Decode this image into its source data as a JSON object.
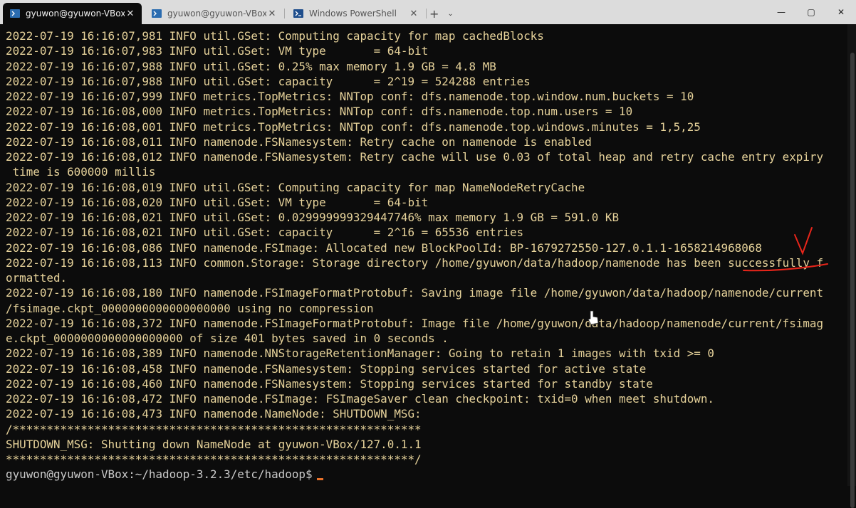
{
  "tabs": [
    {
      "label": "gyuwon@gyuwon-VBox: ~/h",
      "icon": "terminal-icon",
      "active": true
    },
    {
      "label": "gyuwon@gyuwon-VBox: ~/ha",
      "icon": "terminal-icon",
      "active": false
    },
    {
      "label": "Windows PowerShell",
      "icon": "powershell-icon",
      "active": false
    }
  ],
  "window": {
    "new_tab": "+",
    "dropdown": "⌄",
    "minimize": "—",
    "maximize": "▢",
    "close": "✕"
  },
  "terminal": {
    "lines": [
      "2022-07-19 16:16:07,981 INFO util.GSet: Computing capacity for map cachedBlocks",
      "2022-07-19 16:16:07,983 INFO util.GSet: VM type       = 64-bit",
      "2022-07-19 16:16:07,988 INFO util.GSet: 0.25% max memory 1.9 GB = 4.8 MB",
      "2022-07-19 16:16:07,988 INFO util.GSet: capacity      = 2^19 = 524288 entries",
      "2022-07-19 16:16:07,999 INFO metrics.TopMetrics: NNTop conf: dfs.namenode.top.window.num.buckets = 10",
      "2022-07-19 16:16:08,000 INFO metrics.TopMetrics: NNTop conf: dfs.namenode.top.num.users = 10",
      "2022-07-19 16:16:08,001 INFO metrics.TopMetrics: NNTop conf: dfs.namenode.top.windows.minutes = 1,5,25",
      "2022-07-19 16:16:08,011 INFO namenode.FSNamesystem: Retry cache on namenode is enabled",
      "2022-07-19 16:16:08,012 INFO namenode.FSNamesystem: Retry cache will use 0.03 of total heap and retry cache entry expiry",
      " time is 600000 millis",
      "2022-07-19 16:16:08,019 INFO util.GSet: Computing capacity for map NameNodeRetryCache",
      "2022-07-19 16:16:08,020 INFO util.GSet: VM type       = 64-bit",
      "2022-07-19 16:16:08,021 INFO util.GSet: 0.029999999329447746% max memory 1.9 GB = 591.0 KB",
      "2022-07-19 16:16:08,021 INFO util.GSet: capacity      = 2^16 = 65536 entries",
      "2022-07-19 16:16:08,086 INFO namenode.FSImage: Allocated new BlockPoolId: BP-1679272550-127.0.1.1-1658214968068",
      "2022-07-19 16:16:08,113 INFO common.Storage: Storage directory /home/gyuwon/data/hadoop/namenode has been successfully f",
      "ormatted.",
      "2022-07-19 16:16:08,180 INFO namenode.FSImageFormatProtobuf: Saving image file /home/gyuwon/data/hadoop/namenode/current",
      "/fsimage.ckpt_0000000000000000000 using no compression",
      "2022-07-19 16:16:08,372 INFO namenode.FSImageFormatProtobuf: Image file /home/gyuwon/data/hadoop/namenode/current/fsimag",
      "e.ckpt_0000000000000000000 of size 401 bytes saved in 0 seconds .",
      "2022-07-19 16:16:08,389 INFO namenode.NNStorageRetentionManager: Going to retain 1 images with txid >= 0",
      "2022-07-19 16:16:08,458 INFO namenode.FSNamesystem: Stopping services started for active state",
      "2022-07-19 16:16:08,460 INFO namenode.FSNamesystem: Stopping services started for standby state",
      "2022-07-19 16:16:08,472 INFO namenode.FSImage: FSImageSaver clean checkpoint: txid=0 when meet shutdown.",
      "2022-07-19 16:16:08,473 INFO namenode.NameNode: SHUTDOWN_MSG:",
      "/************************************************************",
      "SHUTDOWN_MSG: Shutting down NameNode at gyuwon-VBox/127.0.1.1",
      "************************************************************/"
    ],
    "prompt": "gyuwon@gyuwon-VBox:~/hadoop-3.2.3/etc/hadoop$"
  },
  "colors": {
    "text": "#e6d29a",
    "annotation": "#e8251a",
    "background": "#0c0c0c",
    "cursor": "#e8712a"
  }
}
